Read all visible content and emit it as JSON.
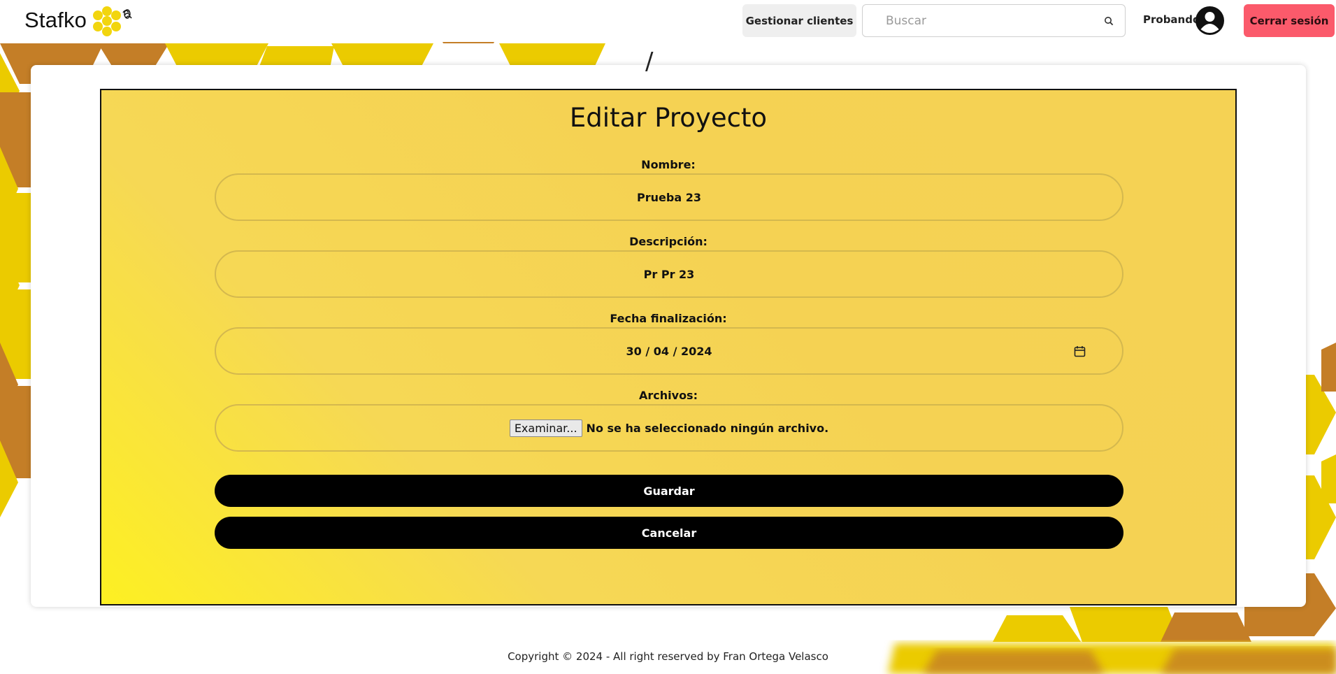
{
  "brand": {
    "name": "Stafko"
  },
  "header": {
    "manage_clients_label": "Gestionar clientes",
    "search_placeholder": "Buscar",
    "user_name": "Probando",
    "logout_label": "Cerrar sesión"
  },
  "form": {
    "title": "Editar Proyecto",
    "fields": [
      {
        "label": "Nombre:",
        "value": "Prueba 23"
      },
      {
        "label": "Descripción:",
        "value": "Pr Pr 23"
      },
      {
        "label": "Fecha finalización:",
        "value": "30 / 04 / 2024"
      },
      {
        "label": "Archivos:",
        "button_label": "Examinar...",
        "value": "No se ha seleccionado ningún archivo."
      }
    ],
    "save_label": "Guardar",
    "cancel_label": "Cancelar"
  },
  "footer": {
    "copyright": "Copyright © 2024 - All right reserved by Fran Ortega Velasco"
  },
  "colors": {
    "accent_yellow": "#f5d254",
    "honey_dark": "#c47e27",
    "honey_light": "#ebcb00",
    "logout_red": "#fb5a6b",
    "button_black": "#000000"
  },
  "icons": {
    "search": "search-icon",
    "avatar": "user-avatar-icon",
    "calendar": "calendar-icon",
    "logo": "honeycomb-bee-icon"
  }
}
